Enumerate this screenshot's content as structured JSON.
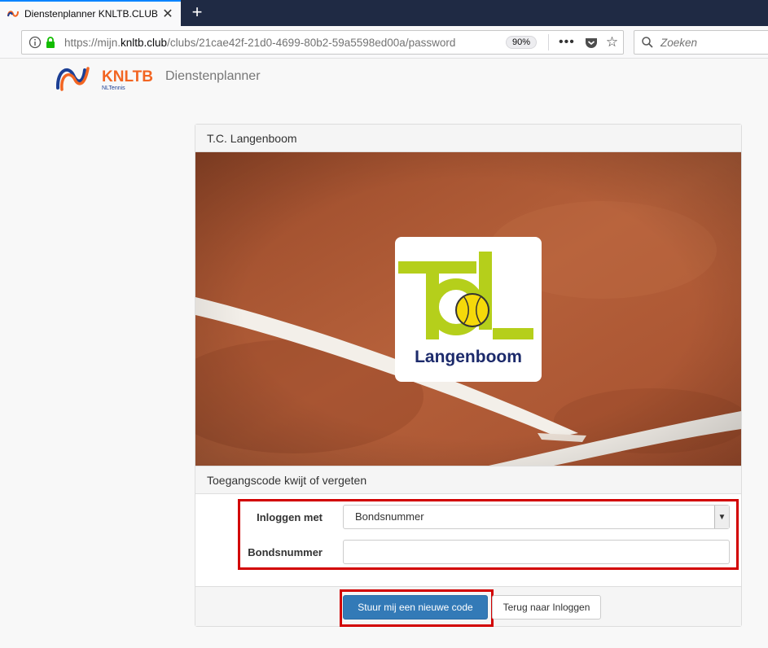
{
  "browser": {
    "tab_title": "Dienstenplanner KNLTB.CLUB",
    "new_tab_symbol": "+",
    "url_prefix": "https://mijn.",
    "url_domain": "knltb.club",
    "url_path": "/clubs/21cae42f-21d0-4699-80b2-59a5598ed00a/password",
    "zoom": "90%",
    "search_placeholder": "Zoeken"
  },
  "header": {
    "logo_text": "KNLTB",
    "logo_subtext": "NLTennis",
    "app_name": "Dienstenplanner"
  },
  "panel": {
    "club_title": "T.C. Langenboom",
    "club_logo_text": "Langenboom",
    "section_title": "Toegangscode kwijt of vergeten"
  },
  "form": {
    "login_with_label": "Inloggen met",
    "login_with_value": "Bondsnummer",
    "member_number_label": "Bondsnummer",
    "member_number_value": ""
  },
  "buttons": {
    "send_code": "Stuur mij een nieuwe code",
    "back_to_login": "Terug naar Inloggen"
  },
  "colors": {
    "primary": "#337ab7",
    "highlight": "#d20000",
    "brand_orange": "#f26522",
    "brand_blue": "#1c3f94",
    "club_green": "#b5cf1b",
    "clay": "#b05a35"
  },
  "icons": {
    "info": "info-icon",
    "lock": "lock-icon",
    "pocket": "pocket-icon",
    "bookmark": "star-icon",
    "search": "search-icon"
  }
}
